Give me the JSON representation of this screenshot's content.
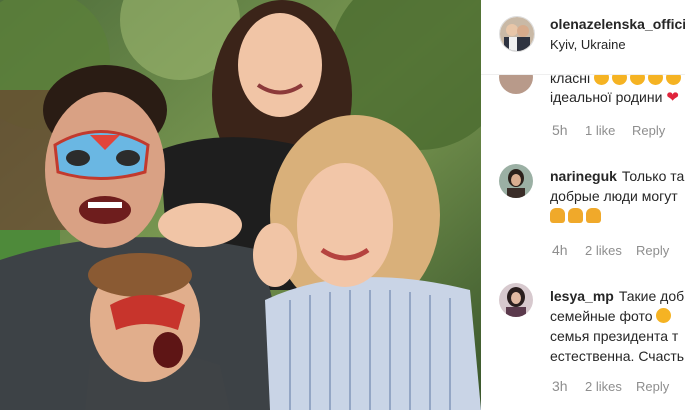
{
  "header": {
    "username": "olenazelenska_offici",
    "location": "Kyiv, Ukraine",
    "avatar_icon": "profile-avatar-icon"
  },
  "comments": [
    {
      "username": "",
      "lines": [
        "класні",
        "ідеальної родини"
      ],
      "time": "5h",
      "likes": "1 like",
      "reply": "Reply"
    },
    {
      "username": "narineguk",
      "lines": [
        "Только та",
        "добрые люди могут"
      ],
      "time": "4h",
      "likes": "2 likes",
      "reply": "Reply"
    },
    {
      "username": "lesya_mp",
      "lines": [
        "Такие доб",
        "семейные фото",
        "семья президента т",
        "естественна. Счасть"
      ],
      "time": "3h",
      "likes": "2 likes",
      "reply": "Reply"
    }
  ],
  "colors": {
    "text": "#262626",
    "meta": "#8e8e8e",
    "emoji": "#f5b323",
    "heart": "#e0243c"
  }
}
